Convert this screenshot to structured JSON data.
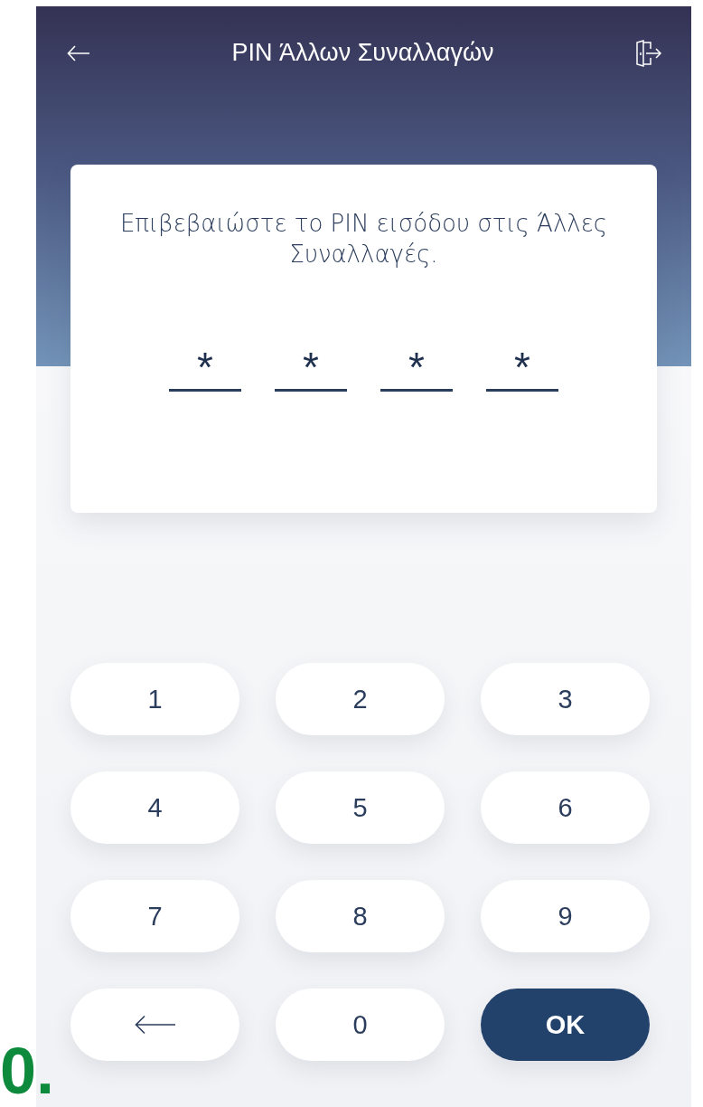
{
  "header": {
    "title": "PIN Άλλων Συναλλαγών"
  },
  "prompt": "Επιβεβαιώστε το PIN εισόδου στις Άλλες Συναλλαγές.",
  "pin_slots": [
    {
      "value": "*"
    },
    {
      "value": "*"
    },
    {
      "value": "*"
    },
    {
      "value": "*"
    }
  ],
  "keypad": [
    {
      "kind": "digit",
      "label": "1"
    },
    {
      "kind": "digit",
      "label": "2"
    },
    {
      "kind": "digit",
      "label": "3"
    },
    {
      "kind": "digit",
      "label": "4"
    },
    {
      "kind": "digit",
      "label": "5"
    },
    {
      "kind": "digit",
      "label": "6"
    },
    {
      "kind": "digit",
      "label": "7"
    },
    {
      "kind": "digit",
      "label": "8"
    },
    {
      "kind": "digit",
      "label": "9"
    },
    {
      "kind": "backspace"
    },
    {
      "kind": "digit",
      "label": "0"
    },
    {
      "kind": "ok",
      "label": "OK"
    }
  ],
  "step_label": "0."
}
